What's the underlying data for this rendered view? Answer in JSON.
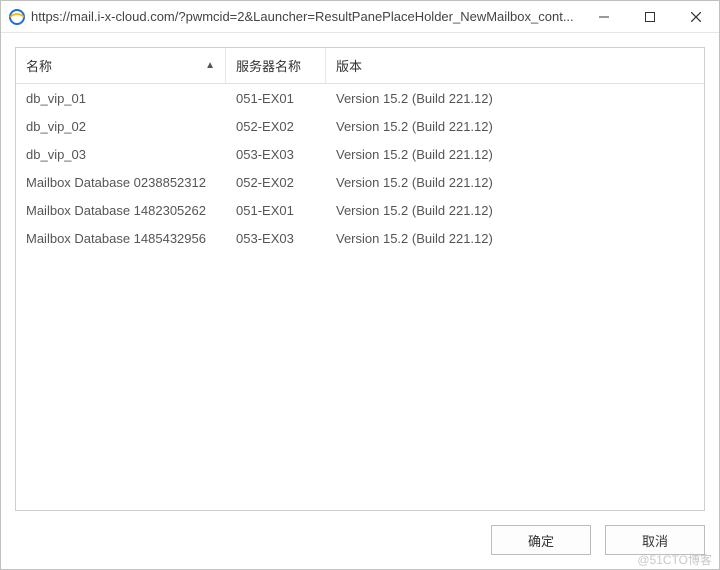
{
  "window": {
    "title": "https://mail.i-x-cloud.com/?pwmcid=2&Launcher=ResultPanePlaceHolder_NewMailbox_cont..."
  },
  "table": {
    "columns": {
      "name": "名称",
      "server": "服务器名称",
      "version": "版本"
    },
    "rows": [
      {
        "name": "db_vip_01",
        "server": "051-EX01",
        "version": "Version 15.2 (Build 221.12)"
      },
      {
        "name": "db_vip_02",
        "server": "052-EX02",
        "version": "Version 15.2 (Build 221.12)"
      },
      {
        "name": "db_vip_03",
        "server": "053-EX03",
        "version": "Version 15.2 (Build 221.12)"
      },
      {
        "name": "Mailbox Database 0238852312",
        "server": "052-EX02",
        "version": "Version 15.2 (Build 221.12)"
      },
      {
        "name": "Mailbox Database 1482305262",
        "server": "051-EX01",
        "version": "Version 15.2 (Build 221.12)"
      },
      {
        "name": "Mailbox Database 1485432956",
        "server": "053-EX03",
        "version": "Version 15.2 (Build 221.12)"
      }
    ]
  },
  "buttons": {
    "ok": "确定",
    "cancel": "取消"
  },
  "sort_glyph": "▲",
  "watermark": "@51CTO博客"
}
